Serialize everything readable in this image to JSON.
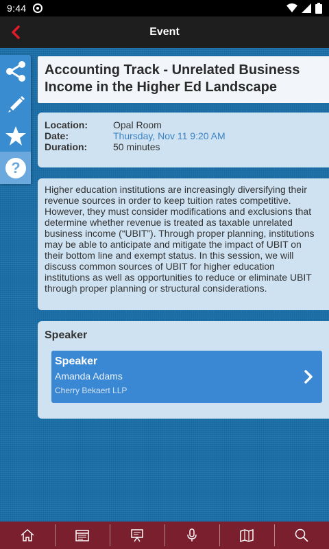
{
  "status_bar": {
    "time": "9:44"
  },
  "app_bar": {
    "title": "Event"
  },
  "event": {
    "title": "Accounting Track - Unrelated Business Income in the Higher Ed Landscape",
    "details": [
      {
        "label": "Location:",
        "value": "Opal Room"
      },
      {
        "label": "Date:",
        "value": "Thursday, Nov 11 9:20 AM"
      },
      {
        "label": "Duration:",
        "value": "50 minutes"
      }
    ],
    "description": "Higher education institutions are increasingly diversifying their revenue sources in order to keep tuition rates competitive. However, they must consider modifications and exclusions that determine whether revenue is treated as taxable unrelated business income (“UBIT”). Through proper planning, institutions may be able to anticipate and mitigate the impact of UBIT on their bottom line and exempt status. In this session, we will discuss common sources of UBIT for higher education institutions as well as opportunities to reduce or eliminate UBIT through proper planning or structural considerations."
  },
  "speaker_section": {
    "heading": "Speaker",
    "speakers": [
      {
        "role": "Speaker",
        "name": "Amanda Adams",
        "org": "Cherry Bekaert LLP"
      }
    ]
  },
  "colors": {
    "accent_link": "#3b82c4",
    "tab_bar": "#7a1f2e",
    "back_arrow": "#e21b2b",
    "speaker_bg": "#3a88d3"
  },
  "side_rail_icons": [
    "share-icon",
    "pencil-icon",
    "star-icon",
    "help-icon"
  ],
  "tab_icons": [
    "home-icon",
    "schedule-icon",
    "presentation-icon",
    "microphone-icon",
    "map-icon",
    "search-icon"
  ]
}
